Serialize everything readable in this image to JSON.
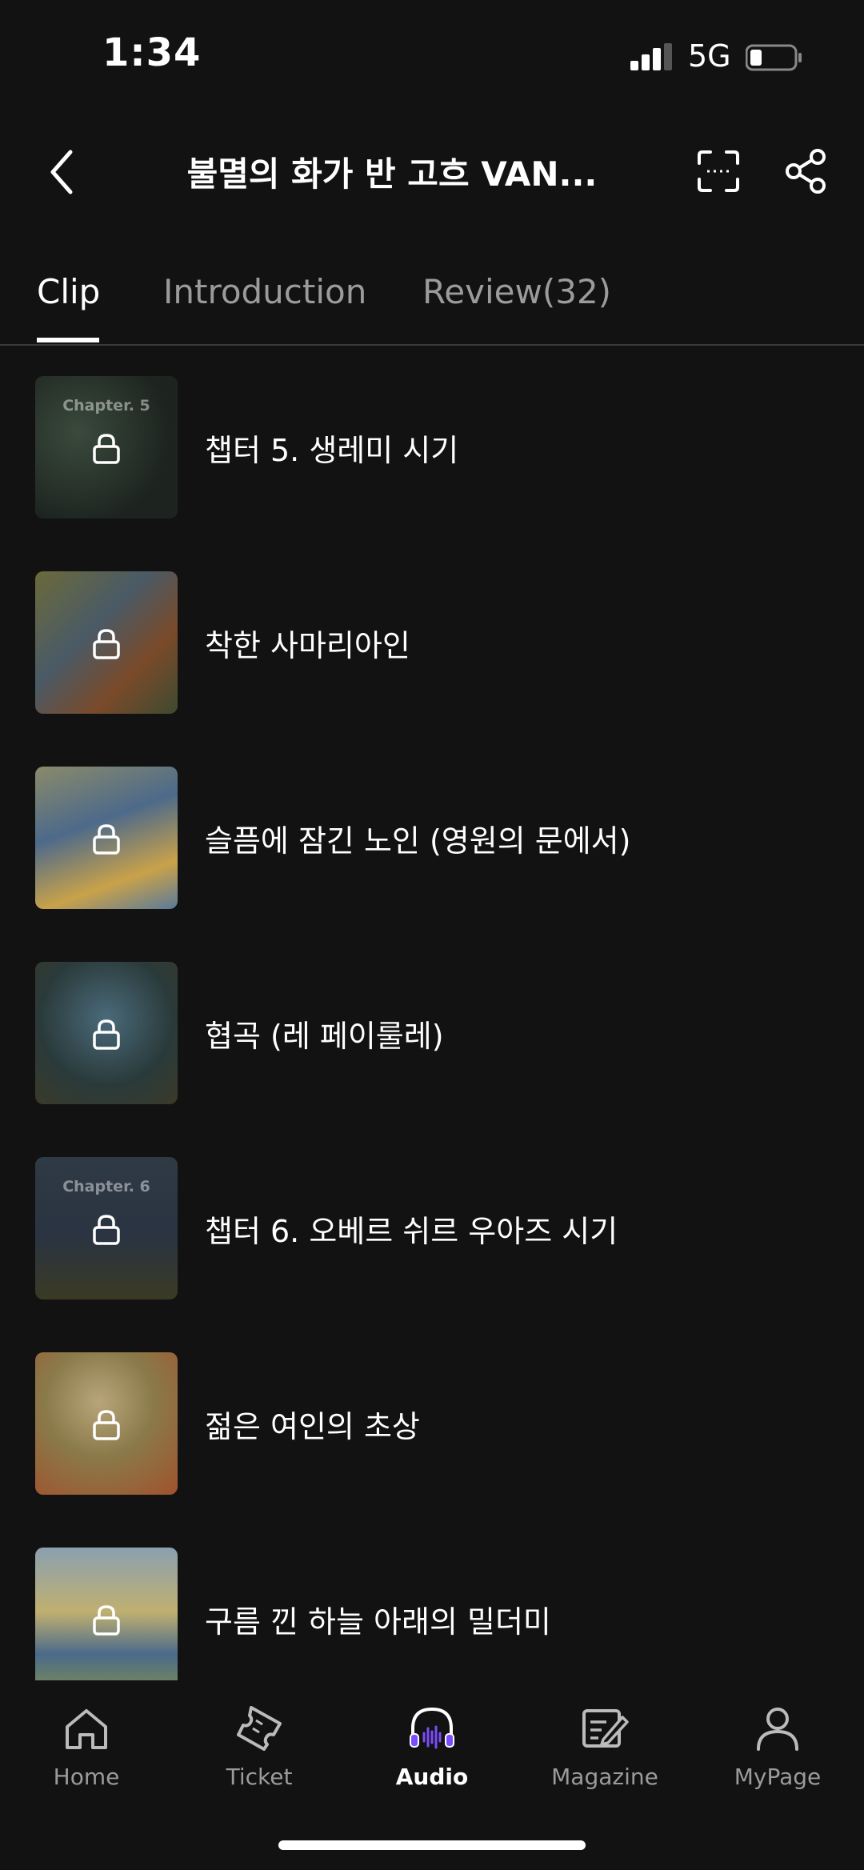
{
  "status": {
    "time": "1:34",
    "network": "5G"
  },
  "header": {
    "title": "불멸의 화가 반 고흐 VAN..."
  },
  "tabs": [
    {
      "label": "Clip",
      "active": true
    },
    {
      "label": "Introduction",
      "active": false
    },
    {
      "label": "Review(32)",
      "active": false
    }
  ],
  "clips": [
    {
      "title": "챕터 5. 생레미 시기",
      "thumb_text": "Chapter. 5",
      "locked": true
    },
    {
      "title": "착한 사마리아인",
      "thumb_text": "",
      "locked": true
    },
    {
      "title": "슬픔에 잠긴 노인 (영원의 문에서)",
      "thumb_text": "",
      "locked": true
    },
    {
      "title": "협곡 (레 페이룰레)",
      "thumb_text": "",
      "locked": true
    },
    {
      "title": "챕터 6. 오베르 쉬르 우아즈 시기",
      "thumb_text": "Chapter. 6",
      "locked": true
    },
    {
      "title": "젊은 여인의 초상",
      "thumb_text": "",
      "locked": true
    },
    {
      "title": "구름 낀 하늘 아래의 밀더미",
      "thumb_text": "",
      "locked": true
    }
  ],
  "nav": [
    {
      "label": "Home",
      "icon": "home-icon",
      "active": false
    },
    {
      "label": "Ticket",
      "icon": "ticket-icon",
      "active": false
    },
    {
      "label": "Audio",
      "icon": "headphones-icon",
      "active": true
    },
    {
      "label": "Magazine",
      "icon": "magazine-icon",
      "active": false
    },
    {
      "label": "MyPage",
      "icon": "person-icon",
      "active": false
    }
  ],
  "colors": {
    "background": "#121212",
    "accent": "#7b4dff",
    "inactive": "#9b9b9b"
  }
}
